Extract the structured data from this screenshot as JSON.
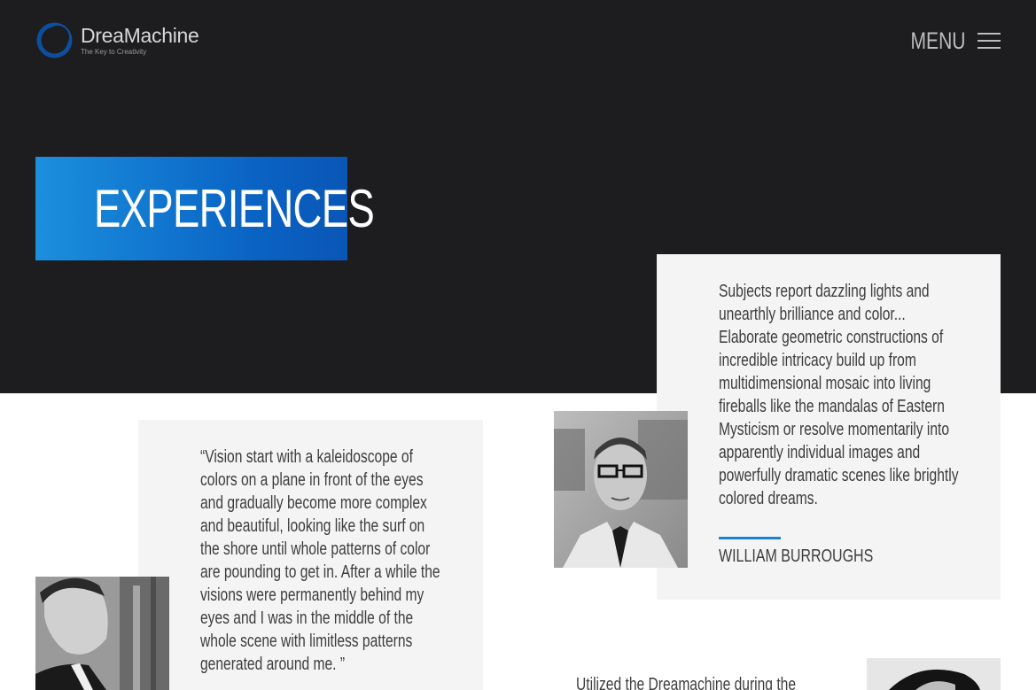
{
  "header": {
    "logo_name": "DreaMachine",
    "logo_tagline": "The Key to Creativity",
    "menu_label": "MENU"
  },
  "hero": {
    "title": "EXPERIENCES"
  },
  "testimonials": [
    {
      "quote_lines": [
        "Subjects report dazzling lights and",
        "unearthly brilliance and color...",
        "Elaborate geometric constructions of",
        "incredible intricacy build up from",
        "multidimensional mosaic into living",
        "fireballs like the mandalas of Eastern",
        "Mysticism or resolve momentarily into",
        "apparently individual images and",
        "powerfully dramatic scenes like brightly",
        "colored dreams."
      ],
      "author": "WILLIAM BURROUGHS"
    },
    {
      "quote_lines": [
        "“Vision start with a kaleidoscope of",
        "colors on a plane in front of the eyes",
        "and gradually become more complex",
        "and beautiful, looking like the surf on",
        "the shore until whole patterns of color",
        "are pounding to get in. After a while the",
        "visions were permanently behind my",
        "eyes and I was in the middle of the",
        "whole scene with limitless patterns",
        "generated around me. ”"
      ]
    }
  ],
  "bottom_snippet": "Utilized the Dreamachine during the",
  "colors": {
    "hero_bg": "#1d1c1e",
    "accent_blue": "#1b82d6",
    "card_bg": "#f4f4f4"
  }
}
